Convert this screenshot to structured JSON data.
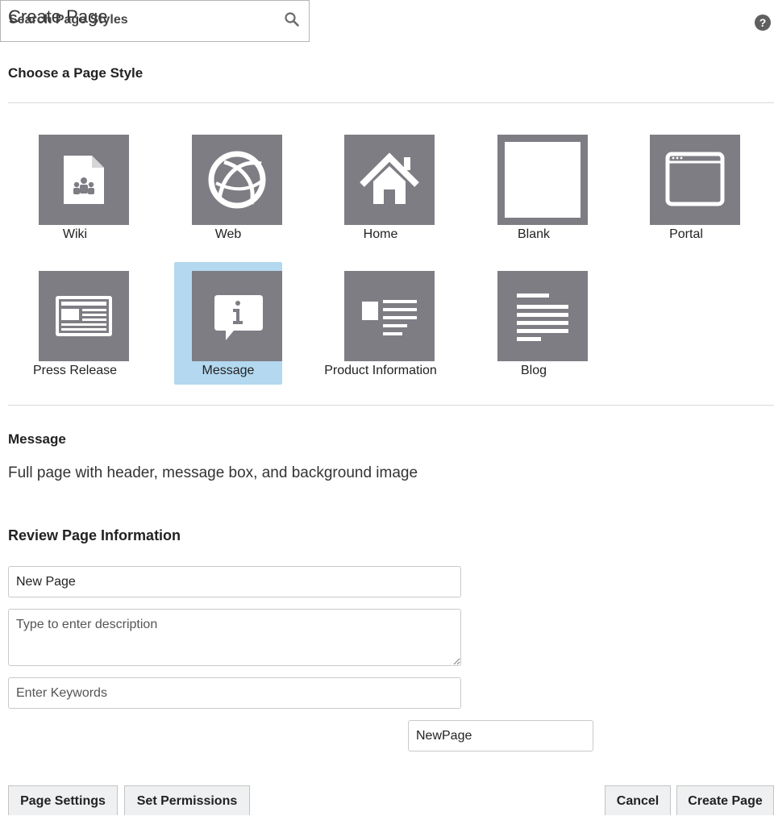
{
  "header": {
    "title": "Create Page",
    "help_icon": "help-icon"
  },
  "styles": {
    "heading": "Choose a Page Style",
    "search_placeholder": "Search Page Styles",
    "tiles": [
      {
        "label": "Wiki",
        "icon": "wiki-icon",
        "selected": false
      },
      {
        "label": "Web",
        "icon": "web-icon",
        "selected": false
      },
      {
        "label": "Home",
        "icon": "home-icon",
        "selected": false
      },
      {
        "label": "Blank",
        "icon": "blank-icon",
        "selected": false
      },
      {
        "label": "Portal",
        "icon": "portal-icon",
        "selected": false
      },
      {
        "label": "Press Release",
        "icon": "press-release-icon",
        "selected": false
      },
      {
        "label": "Message",
        "icon": "message-icon",
        "selected": true
      },
      {
        "label": "Product Information",
        "icon": "product-information-icon",
        "selected": false
      },
      {
        "label": "Blog",
        "icon": "blog-icon",
        "selected": false
      }
    ]
  },
  "selected_style": {
    "title": "Message",
    "description": "Full page with header, message box, and background image"
  },
  "review": {
    "heading": "Review Page Information",
    "name_value": "New Page",
    "description_placeholder": "Type to enter description",
    "keywords_placeholder": "Enter Keywords",
    "url_value": "NewPage"
  },
  "buttons": {
    "page_settings": "Page Settings",
    "set_permissions": "Set Permissions",
    "cancel": "Cancel",
    "create_page": "Create Page"
  },
  "colors": {
    "tile_gray": "#7e7d84",
    "selected_highlight": "#b3d8ef",
    "button_bg": "#eef0f1"
  }
}
